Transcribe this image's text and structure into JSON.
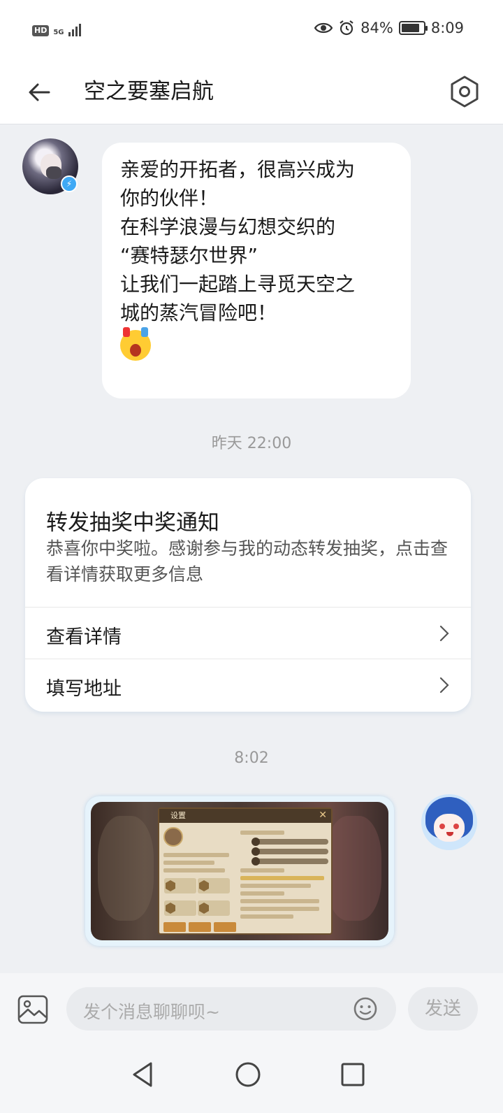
{
  "status_bar": {
    "hd": "HD",
    "network": "5G",
    "battery": "84%",
    "battery_level": 0.84,
    "time": "8:09",
    "icons": [
      "eye-icon",
      "alarm-icon",
      "battery-icon"
    ]
  },
  "header": {
    "title": "空之要塞启航",
    "back_icon": "back-arrow-icon",
    "settings_icon": "settings-hexagon-icon"
  },
  "messages": {
    "welcome": {
      "lines": [
        "亲爱的开拓者，很高兴成为",
        "你的伙伴！",
        "在科学浪漫与幻想交织的",
        "“赛特瑟尔世界”",
        "让我们一起踏上寻觅天空之",
        "城的蒸汽冒险吧！"
      ]
    },
    "timestamp_1": "昨天 22:00",
    "notice": {
      "title": "转发抽奖中奖通知",
      "body": "恭喜你中奖啦。感谢参与我的动态转发抽奖，点击查看详情获取更多信息",
      "actions": [
        {
          "label": "查看详情"
        },
        {
          "label": "填写地址"
        }
      ]
    },
    "timestamp_2": "8:02",
    "image_message": {
      "panel_title": "设置"
    }
  },
  "composer": {
    "placeholder": "发个消息聊聊呗~",
    "send_label": "发送"
  },
  "navigation": {
    "buttons": [
      "back-triangle-icon",
      "home-circle-icon",
      "recents-square-icon"
    ]
  },
  "colors": {
    "background": "#eef0f3",
    "bubble": "#ffffff",
    "verified": "#3fa9f5",
    "muted_text": "#999999"
  }
}
